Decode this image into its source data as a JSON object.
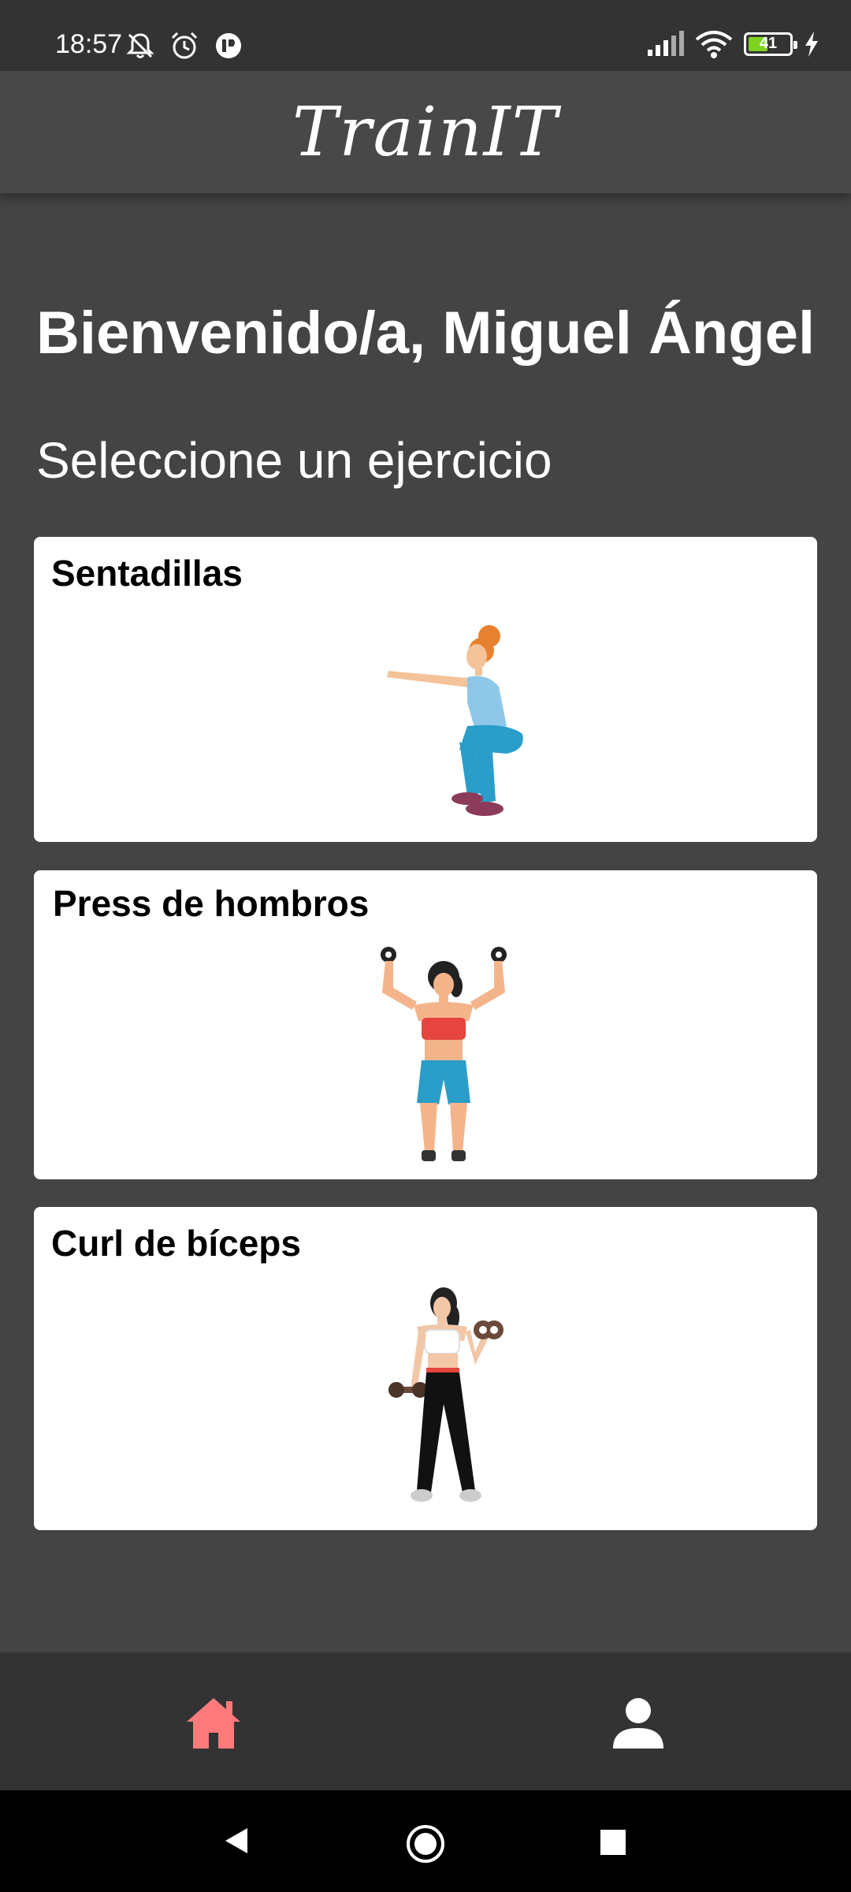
{
  "status_bar": {
    "time": "18:57",
    "battery_level": "41",
    "icons": [
      "mute-icon",
      "alarm-icon",
      "app-notification-icon",
      "signal-icon",
      "wifi-icon",
      "battery-icon",
      "charging-icon"
    ]
  },
  "app_bar": {
    "title": "TrainIT"
  },
  "main": {
    "welcome": "Bienvenido/a, Miguel Ángel",
    "subtitle": "Seleccione un ejercicio",
    "exercises": [
      {
        "label": "Sentadillas"
      },
      {
        "label": "Press de hombros"
      },
      {
        "label": "Curl de bíceps"
      }
    ]
  },
  "bottom_nav": {
    "items": [
      {
        "icon": "home-icon",
        "active": true
      },
      {
        "icon": "profile-icon",
        "active": false
      }
    ],
    "active_color": "#ff7b7b"
  },
  "system_nav": {
    "buttons": [
      "back-button",
      "home-button",
      "recents-button"
    ]
  }
}
